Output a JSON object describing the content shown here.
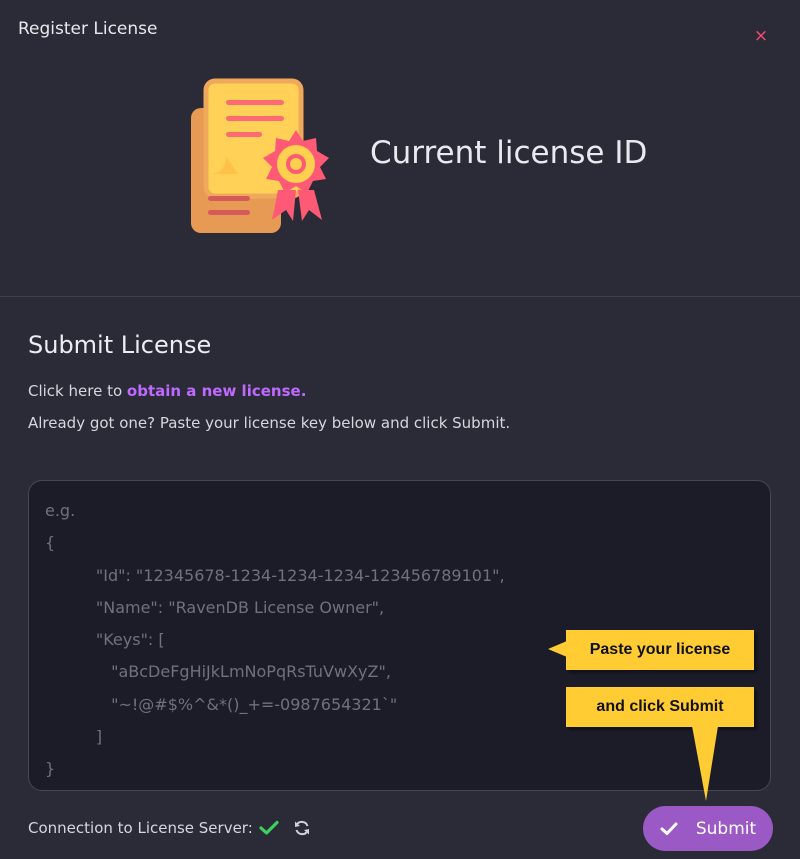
{
  "dialog": {
    "title": "Register License",
    "close_label": "×"
  },
  "hero": {
    "title": "Current license ID"
  },
  "submit_section": {
    "title": "Submit License",
    "obtain_prefix": "Click here to ",
    "obtain_link": "obtain a new license.",
    "instructions": "Already got one? Paste your license key below and click Submit.",
    "placeholder_lines": [
      "e.g.",
      "{",
      "          \"Id\": \"12345678-1234-1234-1234-123456789101\",",
      "          \"Name\": \"RavenDB License Owner\",",
      "          \"Keys\": [",
      "             \"aBcDeFgHiJkLmNoPqRsTuVwXyZ\",",
      "             \"~!@#$%^&*()_+=-0987654321`\"",
      "          ]",
      "}"
    ]
  },
  "callouts": {
    "paste": "Paste your license",
    "click": "and click Submit"
  },
  "footer": {
    "connection_label": "Connection to License Server:",
    "submit_label": "Submit"
  },
  "colors": {
    "accent": "#9b59c6",
    "link": "#c069ff",
    "close": "#ff4a6e",
    "success": "#3ecf5e",
    "callout": "#ffcc33"
  },
  "icons": [
    "license-certificate-icon",
    "close-icon",
    "check-icon",
    "refresh-icon"
  ]
}
